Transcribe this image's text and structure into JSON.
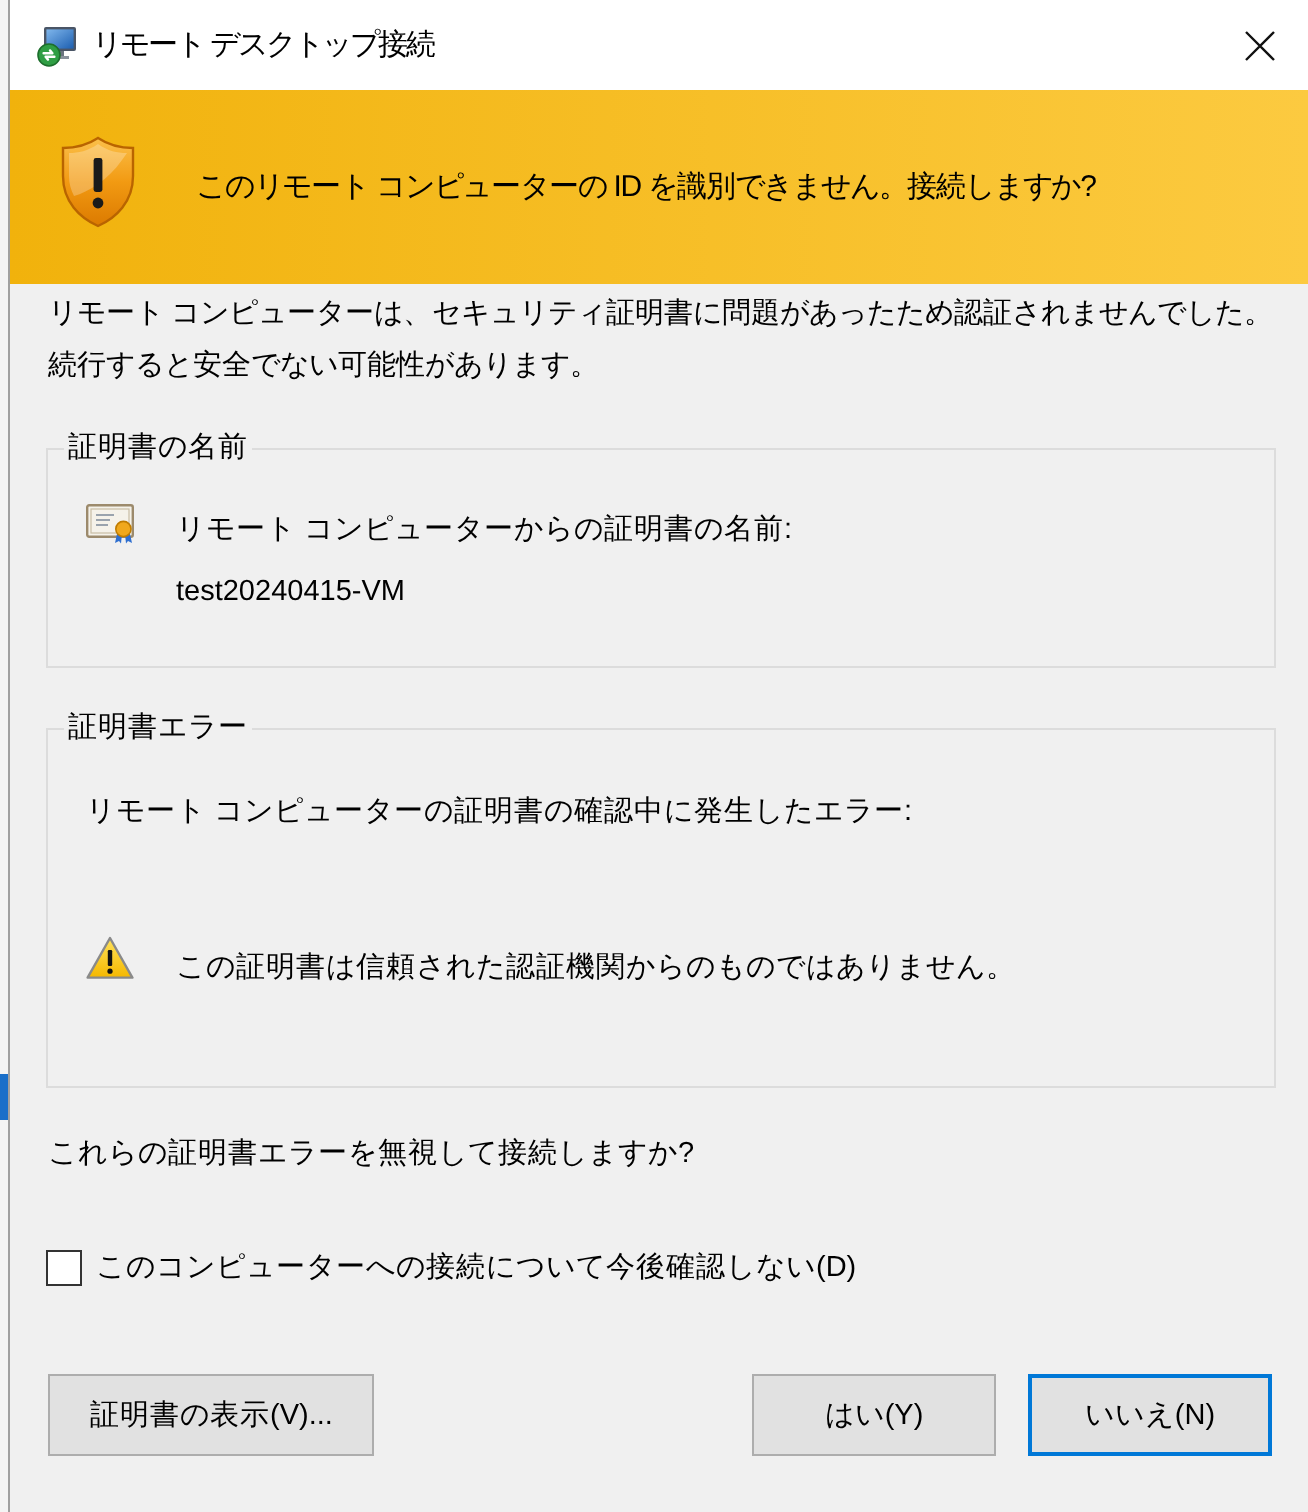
{
  "window": {
    "title": "リモート デスクトップ接続"
  },
  "banner": {
    "message": "このリモート コンピューターの ID を識別できません。接続しますか?"
  },
  "description": [
    "リモート コンピューターは、セキュリティ証明書に問題があったため認証されませんでした。",
    "続行すると安全でない可能性があります。"
  ],
  "certificate_name": {
    "legend": "証明書の名前",
    "label": "リモート コンピューターからの証明書の名前:",
    "value": "test20240415-VM"
  },
  "certificate_errors": {
    "legend": "証明書エラー",
    "intro": "リモート コンピューターの証明書の確認中に発生したエラー:",
    "errors": [
      {
        "text": "この証明書は信頼された認証機関からのものではありません。"
      }
    ]
  },
  "question": "これらの証明書エラーを無視して接続しますか?",
  "dont_ask_again": {
    "label": "このコンピューターへの接続について今後確認しない(D)",
    "checked": false
  },
  "buttons": [
    {
      "label": "証明書の表示(V)...",
      "default": false
    },
    {
      "label": "はい(Y)",
      "default": false
    },
    {
      "label": "いいえ(N)",
      "default": true
    }
  ]
}
